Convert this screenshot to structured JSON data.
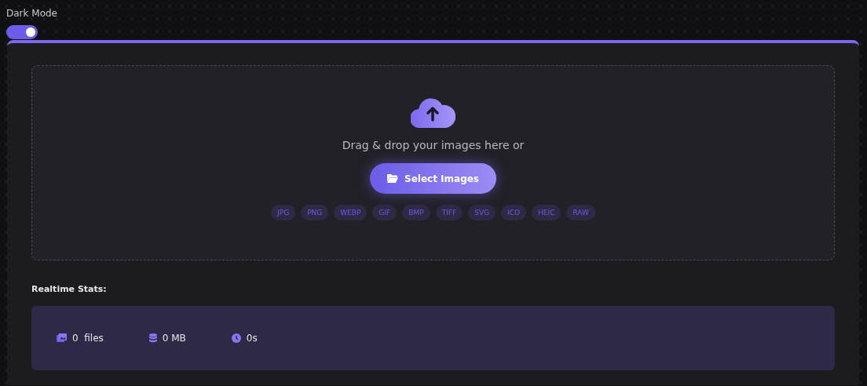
{
  "theme_toggle": {
    "label": "Dark Mode",
    "on": true
  },
  "dropzone": {
    "prompt": "Drag & drop your images here or",
    "button": "Select Images",
    "formats": [
      "JPG",
      "PNG",
      "WEBP",
      "GIF",
      "BMP",
      "TIFF",
      "SVG",
      "ICO",
      "HEIC",
      "RAW"
    ]
  },
  "stats": {
    "title": "Realtime Stats:",
    "items": [
      {
        "kind": "files",
        "text": "0  files"
      },
      {
        "kind": "size",
        "text": "0 MB"
      },
      {
        "kind": "time",
        "text": "0s"
      }
    ]
  }
}
